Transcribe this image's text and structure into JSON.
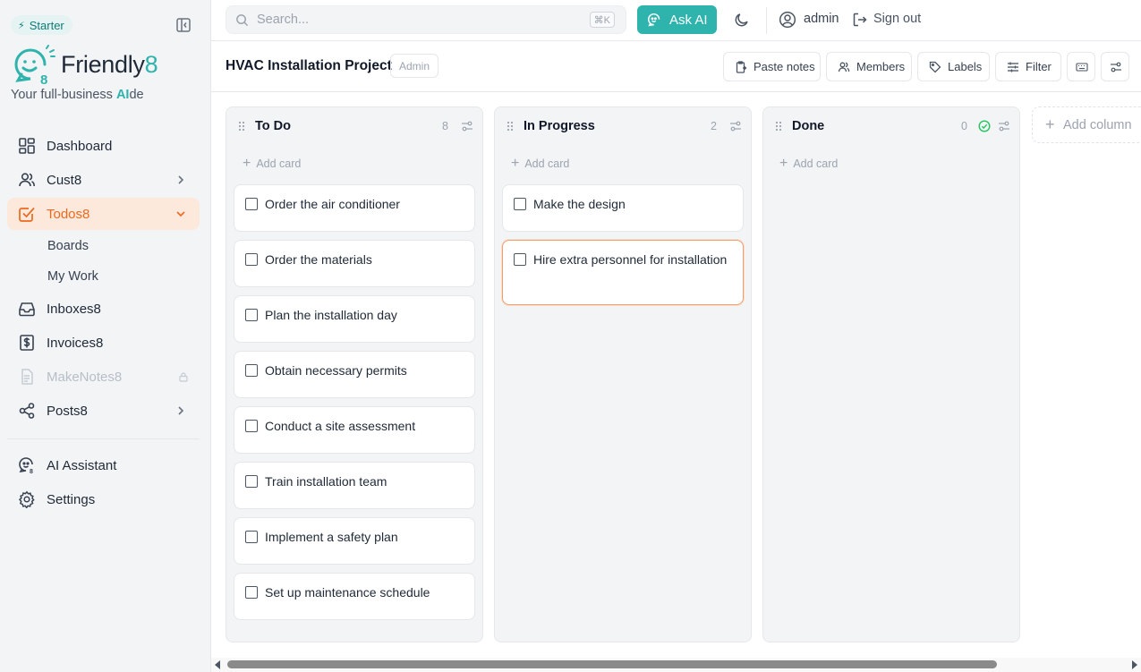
{
  "sidebar": {
    "plan_badge": "Starter",
    "logo_text": "Friendly",
    "logo_eight": "8",
    "tagline_pre": "Your full-business ",
    "tagline_ai": "AI",
    "tagline_post": "de",
    "nav": {
      "dashboard": "Dashboard",
      "cust8": "Cust8",
      "todos8": "Todos8",
      "boards": "Boards",
      "my_work": "My Work",
      "inboxes8": "Inboxes8",
      "invoices8": "Invoices8",
      "makenotes8": "MakeNotes8",
      "posts8": "Posts8",
      "ai_assistant": "AI Assistant",
      "settings": "Settings"
    }
  },
  "topbar": {
    "search_placeholder": "Search...",
    "shortcut": "⌘K",
    "ask_ai": "Ask AI",
    "username": "admin",
    "sign_out": "Sign out"
  },
  "project": {
    "title": "HVAC Installation Project",
    "role": "Admin",
    "toolbar": {
      "paste_notes": "Paste notes",
      "members": "Members",
      "labels": "Labels",
      "filter": "Filter"
    }
  },
  "board": {
    "add_card_label": "Add card",
    "add_column_label": "Add column",
    "columns": [
      {
        "title": "To Do",
        "count": "8",
        "cards": [
          "Order the air conditioner",
          "Order the materials",
          "Plan the installation day",
          "Obtain necessary permits",
          "Conduct a site assessment",
          "Train installation team",
          "Implement a safety plan",
          "Set up maintenance schedule"
        ]
      },
      {
        "title": "In Progress",
        "count": "2",
        "cards": [
          "Make the design",
          "Hire extra personnel for installation"
        ]
      },
      {
        "title": "Done",
        "count": "0",
        "cards": []
      }
    ]
  },
  "colors": {
    "brand_teal": "#2fb3ad",
    "active_orange": "#ea6a1f",
    "active_bg": "#fde8dc"
  }
}
